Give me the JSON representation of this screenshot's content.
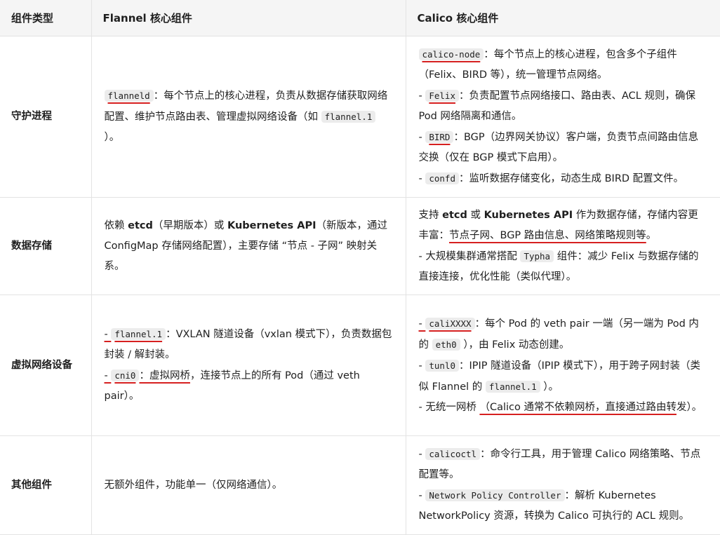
{
  "header": {
    "col1": "组件类型",
    "col2": "Flannel 核心组件",
    "col3": "Calico 核心组件"
  },
  "rows": [
    {
      "label": "守护进程",
      "flannel": {
        "p0_code": "flanneld",
        "p0_a": "：每个节点上的核心进程，负责从数据存储获取网络配置、维护节点路由表、管理虚拟网络设备（如 ",
        "p0_code2": "flannel.1",
        "p0_b": " ）。"
      },
      "calico": {
        "l0_code": "calico-node",
        "l0_text": "：每个节点上的核心进程，包含多个子组件（Felix、BIRD 等），统一管理节点网络。",
        "l1_pre": "- ",
        "l1_code": "Felix",
        "l1_text": "：负责配置节点网络接口、路由表、ACL 规则，确保 Pod 网络隔离和通信。",
        "l2_pre": "- ",
        "l2_code": "BIRD",
        "l2_text": "：BGP（边界网关协议）客户端，负责节点间路由信息交换（仅在 BGP 模式下启用）。",
        "l3_pre": "- ",
        "l3_code": "confd",
        "l3_text": "：监听数据存储变化，动态生成 BIRD 配置文件。"
      }
    },
    {
      "label": "数据存储",
      "flannel": {
        "a": "依赖 ",
        "b1": "etcd",
        "c": "（早期版本）或 ",
        "b2": "Kubernetes API",
        "d": "（新版本，通过 ConfigMap 存储网络配置），主要存储 “节点 - 子网” 映射关系。"
      },
      "calico": {
        "a": "支持 ",
        "b1": "etcd",
        "c": " 或 ",
        "b2": "Kubernetes API",
        "d": " 作为数据存储，存储内容更丰富：",
        "u": "节点子网、BGP 路由信息、网络策略规则等",
        "e": "。",
        "l1_a": "- 大规模集群通常搭配 ",
        "l1_code": "Typha",
        "l1_b": " 组件：减少 Felix 与数据存储的直接连接，优化性能（类似代理）。"
      }
    },
    {
      "label": "虚拟网络设备",
      "flannel": {
        "l0_pre": "- ",
        "l0_code": "flannel.1",
        "l0_text": "：VXLAN 隧道设备（vxlan 模式下），负责数据包封装 / 解封装。",
        "l1_pre": "- ",
        "l1_code": "cni0",
        "l1_u": "：虚拟网桥",
        "l1_text": "，连接节点上的所有 Pod（通过 veth pair）。"
      },
      "calico": {
        "l0_pre": "- ",
        "l0_code": "caliXXXX",
        "l0_a": "：每个 Pod 的 veth pair 一端（另一端为 Pod 内的 ",
        "l0_code2": "eth0",
        "l0_b": " ），由 Felix 动态创建。",
        "l1_pre": "- ",
        "l1_code": "tunl0",
        "l1_a": "：IPIP 隧道设备（IPIP 模式下），用于跨子网封装（类似 Flannel 的 ",
        "l1_code2": "flannel.1",
        "l1_b": " ）。",
        "l2_a": "- 无统一网桥 ",
        "l2_u": "（Calico 通常不依赖网桥，直接通过路由转",
        "l2_b": "发）。"
      }
    },
    {
      "label": "其他组件",
      "flannel": {
        "text": "无额外组件，功能单一（仅网络通信）。"
      },
      "calico": {
        "l0_pre": "- ",
        "l0_code": "calicoctl",
        "l0_text": "：命令行工具，用于管理 Calico 网络策略、节点配置等。",
        "l1_pre": "- ",
        "l1_code": "Network Policy Controller",
        "l1_text": "：解析 Kubernetes NetworkPolicy 资源，转换为 Calico 可执行的 ACL 规则。"
      }
    }
  ]
}
